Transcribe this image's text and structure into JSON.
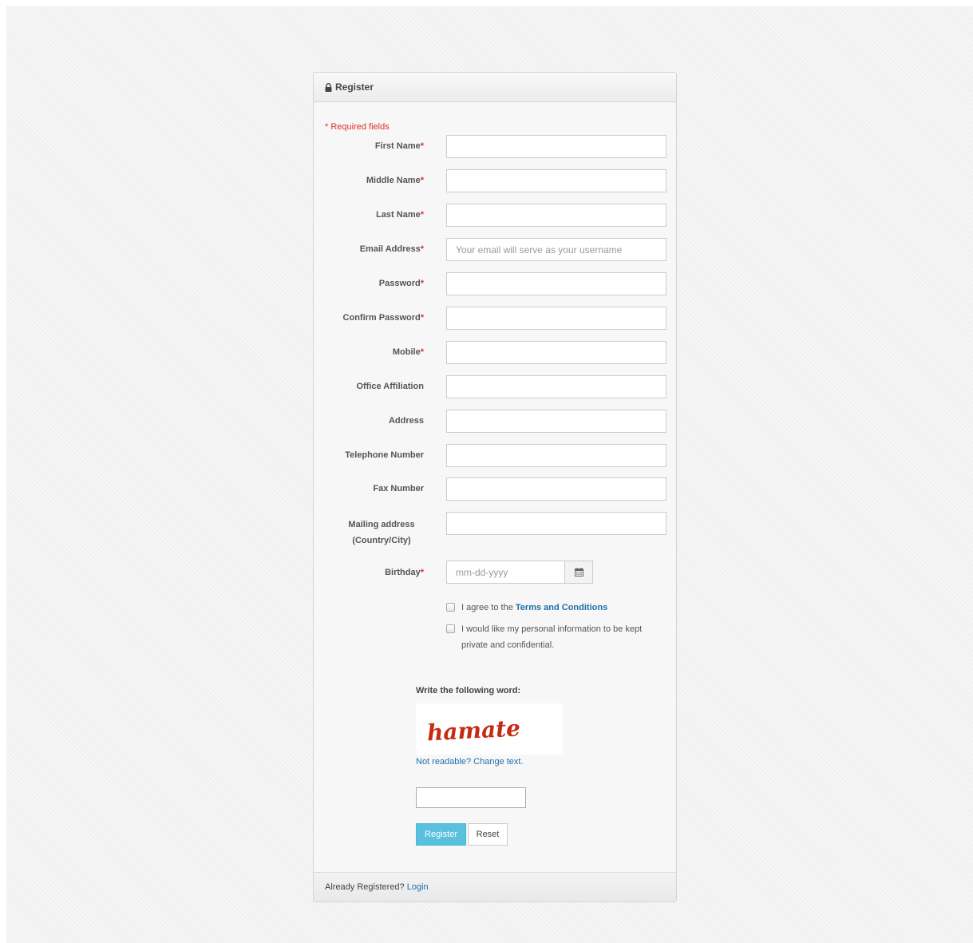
{
  "panel": {
    "title": "Register",
    "title_icon": "lock-icon"
  },
  "required_note": "* Required fields",
  "fields": [
    {
      "label": "First Name",
      "required": "*",
      "value": "",
      "placeholder": ""
    },
    {
      "label": "Middle Name",
      "required": "*",
      "value": "",
      "placeholder": ""
    },
    {
      "label": "Last Name",
      "required": "*",
      "value": "",
      "placeholder": ""
    },
    {
      "label": "Email Address",
      "required": "*",
      "value": "",
      "placeholder": "Your email will serve as your username"
    },
    {
      "label": "Password",
      "required": "*",
      "value": "",
      "placeholder": ""
    },
    {
      "label": "Confirm Password",
      "required": "*",
      "value": "",
      "placeholder": ""
    },
    {
      "label": "Mobile",
      "required": "*",
      "value": "",
      "placeholder": ""
    },
    {
      "label": "Office Affiliation",
      "required": "",
      "value": "",
      "placeholder": ""
    },
    {
      "label": "Address",
      "required": "",
      "value": "",
      "placeholder": ""
    },
    {
      "label": "Telephone Number",
      "required": "",
      "value": "",
      "placeholder": ""
    },
    {
      "label": "Fax Number",
      "required": "",
      "value": "",
      "placeholder": ""
    },
    {
      "label_line1": "Mailing address",
      "label_line2": "(Country/City)",
      "required": "",
      "value": "",
      "placeholder": ""
    }
  ],
  "birthday": {
    "label": "Birthday",
    "required": "*",
    "placeholder": "mm-dd-yyyy",
    "button_icon": "calendar-icon"
  },
  "checkboxes": {
    "terms": {
      "prefix": "I agree to the ",
      "link": "Terms and Conditions",
      "checked": false
    },
    "privacy": {
      "text": "I would like my personal information to be kept private and confidential.",
      "checked": false
    }
  },
  "captcha": {
    "label": "Write the following word:",
    "word": "hamate",
    "change_link": "Not readable? Change text.",
    "input_value": ""
  },
  "buttons": {
    "register": "Register",
    "reset": "Reset"
  },
  "footer": {
    "text": "Already Registered? ",
    "link": "Login"
  },
  "colors": {
    "accent_link": "#1f6fa8",
    "required": "#e0302b",
    "register_button": "#5bc0de",
    "captcha_text": "#c62a12"
  }
}
